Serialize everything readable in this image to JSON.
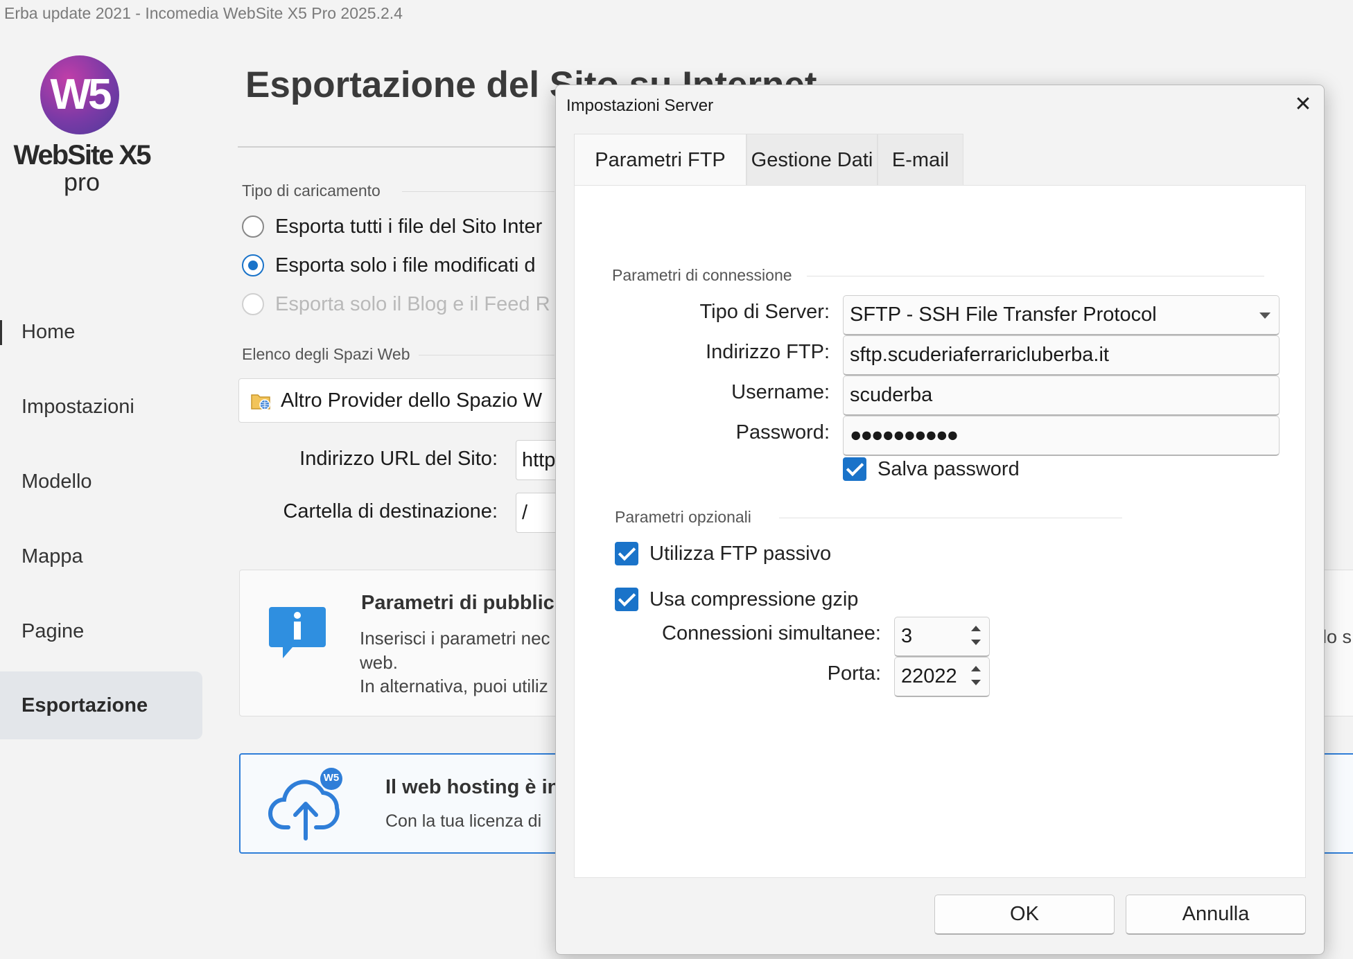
{
  "window": {
    "title": "Erba update 2021 - Incomedia WebSite X5 Pro 2025.2.4"
  },
  "logo": {
    "mark": "W5",
    "name": "WebSite X5",
    "edition": "pro"
  },
  "sidebar": {
    "items": [
      {
        "label": "Home"
      },
      {
        "label": "Impostazioni"
      },
      {
        "label": "Modello"
      },
      {
        "label": "Mappa"
      },
      {
        "label": "Pagine"
      },
      {
        "label": "Esportazione",
        "active": true
      }
    ]
  },
  "main": {
    "title": "Esportazione del Sito su Internet",
    "upload_type": {
      "label": "Tipo di caricamento",
      "options": [
        {
          "label": "Esporta tutti i file del Sito Inter",
          "selected": false,
          "enabled": true
        },
        {
          "label": "Esporta solo i file modificati d",
          "selected": true,
          "enabled": true
        },
        {
          "label": "Esporta solo il Blog e il Feed R",
          "selected": false,
          "enabled": false
        }
      ]
    },
    "webspaces": {
      "label": "Elenco degli Spazi Web",
      "selected": "Altro Provider dello Spazio W",
      "icon": "folder-globe-icon"
    },
    "site_url": {
      "label": "Indirizzo URL del Sito:",
      "value": "http"
    },
    "dest_folder": {
      "label": "Cartella di destinazione:",
      "value": "/"
    },
    "info": {
      "icon": "info-icon",
      "title": "Parametri di pubblic",
      "line1": "Inserisci i parametri nec",
      "line2": "web.",
      "line3": "In alternativa, puoi utiliz",
      "right_fragment": "lo s"
    },
    "hosting": {
      "icon": "cloud-upload-icon",
      "badge": "W5",
      "title": "Il web hosting è in",
      "text": "Con la tua licenza di "
    }
  },
  "dialog": {
    "title": "Impostazioni Server",
    "close_glyph": "✕",
    "tabs": [
      {
        "label": "Parametri FTP",
        "active": true
      },
      {
        "label": "Gestione Dati",
        "active": false
      },
      {
        "label": "E-mail",
        "active": false
      }
    ],
    "connection": {
      "label": "Parametri di connessione",
      "server_type": {
        "label": "Tipo di Server:",
        "value": "SFTP - SSH File Transfer Protocol"
      },
      "ftp_address": {
        "label": "Indirizzo FTP:",
        "value": "sftp.scuderiaferraricluberba.it"
      },
      "username": {
        "label": "Username:",
        "value": "scuderba"
      },
      "password": {
        "label": "Password:",
        "value": "●●●●●●●●●●"
      },
      "save_password": {
        "label": "Salva password",
        "checked": true
      }
    },
    "optional": {
      "label": "Parametri opzionali",
      "passive_ftp": {
        "label": "Utilizza FTP passivo",
        "checked": true
      },
      "gzip": {
        "label": "Usa compressione gzip",
        "checked": true
      },
      "connections": {
        "label": "Connessioni simultanee:",
        "value": "3"
      },
      "port": {
        "label": "Porta:",
        "value": "22022"
      }
    },
    "buttons": {
      "ok": "OK",
      "cancel": "Annulla"
    }
  },
  "colors": {
    "accent": "#1a73c9",
    "hosting_border": "#2f7ed8",
    "logo_purple": "#7a3aa6"
  }
}
